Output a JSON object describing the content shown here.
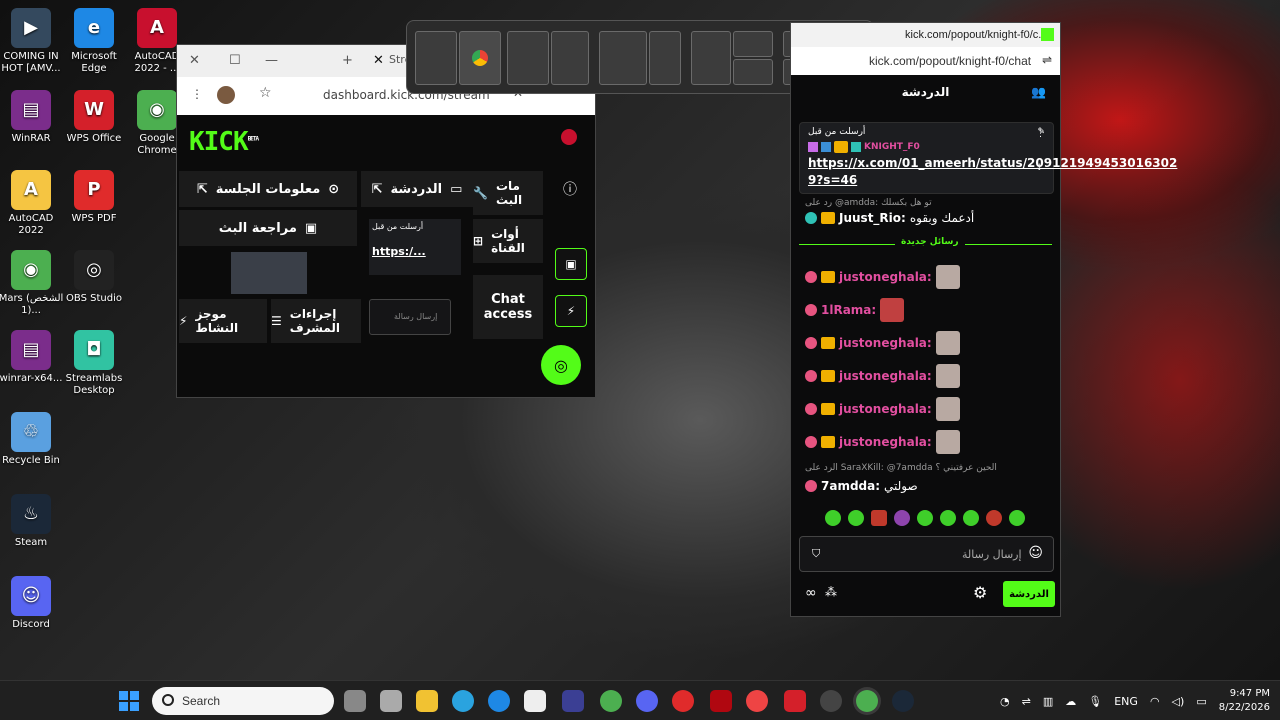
{
  "desktop": {
    "icons": [
      {
        "label": "COMING IN HOT [AMV...",
        "symbol": "▶",
        "color": "#34495e"
      },
      {
        "label": "Microsoft Edge",
        "symbol": "e",
        "color": "#1e88e5"
      },
      {
        "label": "AutoCAD 2022 - ...",
        "symbol": "A",
        "color": "#c8102e"
      },
      {
        "label": "WinRAR",
        "symbol": "▤",
        "color": "#7b2d8b"
      },
      {
        "label": "WPS Office",
        "symbol": "W",
        "color": "#d4202a"
      },
      {
        "label": "Google Chrome",
        "symbol": "◉",
        "color": "#4caf50"
      },
      {
        "label": "AutoCAD 2022",
        "symbol": "A",
        "color": "#f5c542"
      },
      {
        "label": "WPS PDF",
        "symbol": "P",
        "color": "#e02b2b"
      },
      {
        "label": "Mars (الشخص 1)...",
        "symbol": "◉",
        "color": "#4caf50"
      },
      {
        "label": "OBS Studio",
        "symbol": "◎",
        "color": "#222222"
      },
      {
        "label": "winrar-x64...",
        "symbol": "▤",
        "color": "#7b2d8b"
      },
      {
        "label": "Streamlabs Desktop",
        "symbol": "◘",
        "color": "#31c3a2"
      },
      {
        "label": "Recycle Bin",
        "symbol": "♲",
        "color": "#5aa0e0"
      },
      {
        "label": "Steam",
        "symbol": "♨",
        "color": "#1b2838"
      },
      {
        "label": "Discord",
        "symbol": "☺",
        "color": "#5865f2"
      }
    ]
  },
  "browser": {
    "tab_label": "Strea",
    "address": "dashboard.kick.com/stream",
    "logo": "KICK",
    "logo_badge": "BETA",
    "panels": {
      "session_info": "معلومات الجلسة",
      "chat": "الدردشة",
      "stream_settings": "مات البث",
      "stream_review": "مراجعة البث",
      "channel_tools": "أوات القناة",
      "activity_summary": "موجز النشاط",
      "mod_actions": "إجراءات المشرف",
      "chat_access": "Chat access"
    },
    "mini_chat": {
      "pinned_label": "أرسلت من قبل",
      "link": "https:/...",
      "input_placeholder": "إرسال رسالة"
    }
  },
  "chat_window": {
    "title": "kick.com/popout/knight-f0/c...",
    "url": "kick.com/popout/knight-f0/chat",
    "header": "الدردشة",
    "pinned": {
      "label": "أرسلت من قبل",
      "author": "KNIGHT_F0",
      "link": "https://x.com/01_ameerh/status/209121949453016302 9?s=46"
    },
    "reply_1": "رد على @amdda: تو هل بكسلك",
    "msg_juust": {
      "user": "Juust_Rio:",
      "text": "أدعمك وبقوه"
    },
    "new_messages": "رسائل جديدة",
    "messages": [
      {
        "user": "justoneghala:",
        "avatar_color": "#b8a9a2"
      },
      {
        "user": "1lRama:",
        "avatar_color": "#c04040"
      },
      {
        "user": "justoneghala:",
        "avatar_color": "#b8a9a2"
      },
      {
        "user": "justoneghala:",
        "avatar_color": "#b8a9a2"
      },
      {
        "user": "justoneghala:",
        "avatar_color": "#b8a9a2"
      },
      {
        "user": "justoneghala:",
        "avatar_color": "#b8a9a2"
      }
    ],
    "reply_2": "الرد على SaraXKill: @7amdda الحين عرفتيني ؟",
    "msg_7amdda": {
      "user": "7amdda:",
      "text": "صولتي"
    },
    "input_placeholder": "إرسال رسالة",
    "send_label": "الدردشة"
  },
  "taskbar": {
    "search_placeholder": "Search",
    "language": "ENG",
    "time": "9:47 PM",
    "date": "8/22/2026"
  },
  "colors": {
    "kick_green": "#53fc18",
    "accent_red": "#c8102e"
  }
}
